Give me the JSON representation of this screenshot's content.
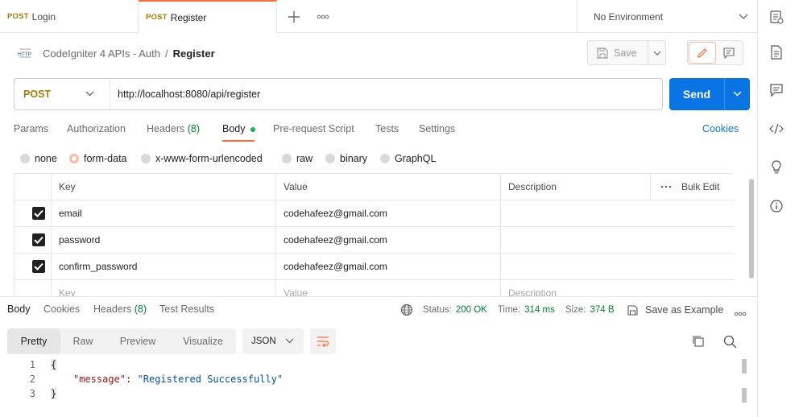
{
  "tabs": [
    {
      "method": "POST",
      "name": "Login"
    },
    {
      "method": "POST",
      "name": "Register"
    }
  ],
  "environment": "No Environment",
  "breadcrumb": {
    "icon_text": "HTTP",
    "collection": "CodeIgniter 4 APIs - Auth",
    "separator": "/",
    "request": "Register"
  },
  "save_label": "Save",
  "request": {
    "method": "POST",
    "url": "http://localhost:8080/api/register",
    "send_label": "Send"
  },
  "subtabs": {
    "params": "Params",
    "authorization": "Authorization",
    "headers": "Headers",
    "headers_count": "(8)",
    "body": "Body",
    "prerequest": "Pre-request Script",
    "tests": "Tests",
    "settings": "Settings",
    "cookies": "Cookies"
  },
  "body_types": [
    "none",
    "form-data",
    "x-www-form-urlencoded",
    "raw",
    "binary",
    "GraphQL"
  ],
  "body_selected": "form-data",
  "table": {
    "headers": {
      "key": "Key",
      "value": "Value",
      "description": "Description",
      "bulk_edit": "Bulk Edit"
    },
    "rows": [
      {
        "checked": true,
        "key": "email",
        "value": "codehafeez@gmail.com",
        "description": ""
      },
      {
        "checked": true,
        "key": "password",
        "value": "codehafeez@gmail.com",
        "description": ""
      },
      {
        "checked": true,
        "key": "confirm_password",
        "value": "codehafeez@gmail.com",
        "description": ""
      }
    ],
    "placeholder": {
      "key": "Key",
      "value": "Value",
      "description": "Description"
    }
  },
  "response": {
    "tabs": {
      "body": "Body",
      "cookies": "Cookies",
      "headers": "Headers",
      "headers_count": "(8)",
      "test_results": "Test Results"
    },
    "status_label": "Status:",
    "status_value": "200 OK",
    "time_label": "Time:",
    "time_value": "314 ms",
    "size_label": "Size:",
    "size_value": "374 B",
    "save_example": "Save as Example",
    "views": [
      "Pretty",
      "Raw",
      "Preview",
      "Visualize"
    ],
    "format": "JSON",
    "code_lines": [
      "1",
      "2",
      "3"
    ],
    "code": {
      "open": "{",
      "key": "\"message\"",
      "colon": ":",
      "value": "\"Registered Successfully\"",
      "close": "}"
    }
  },
  "colors": {
    "accent": "#ff6c37",
    "send": "#0b74e5",
    "post": "#a07c00",
    "status": "#007f31"
  }
}
